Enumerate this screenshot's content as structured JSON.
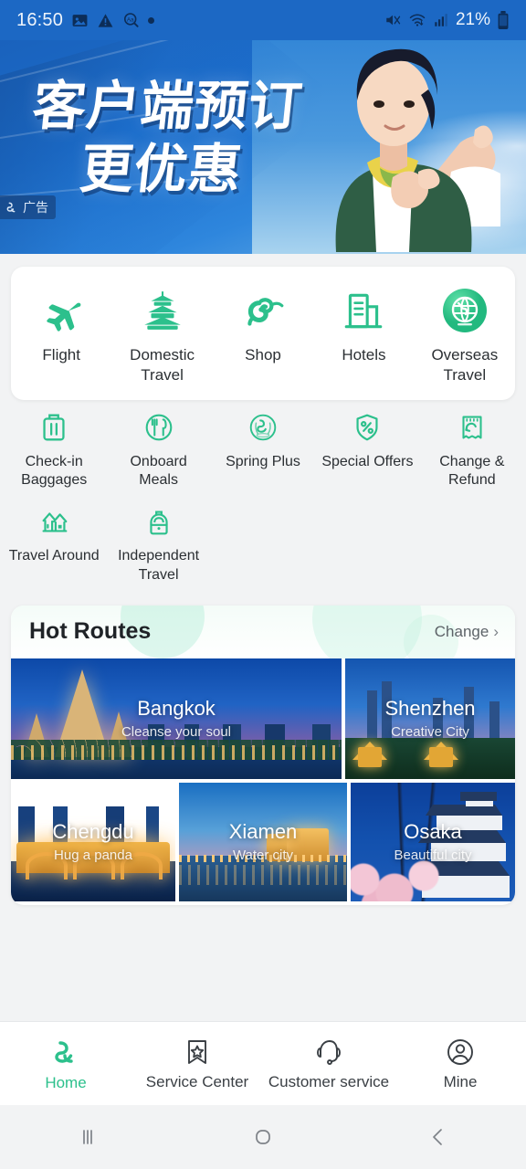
{
  "status_bar": {
    "time": "16:50",
    "left_icons": [
      "image-icon",
      "warning-triangle-icon",
      "text-magnifier-icon",
      "dot-indicator"
    ],
    "battery_percent": "21%",
    "right_icons": [
      "sound-muted-icon",
      "wifi-icon",
      "cellular-signal-icon",
      "battery-icon"
    ]
  },
  "banner": {
    "line1": "客户端预订",
    "line2": "更优惠",
    "ad_label": "广告",
    "background_color": "#1c68c4"
  },
  "primary_grid": [
    {
      "label": "Flight",
      "icon": "airplane-icon"
    },
    {
      "label": "Domestic Travel",
      "icon": "pagoda-icon"
    },
    {
      "label": "Shop",
      "icon": "cloud-swirl-icon"
    },
    {
      "label": "Hotels",
      "icon": "buildings-icon"
    },
    {
      "label": "Overseas Travel",
      "icon": "globe-icon"
    }
  ],
  "secondary_grid": [
    {
      "label": "Check-in Baggages",
      "icon": "suitcase-icon"
    },
    {
      "label": "Onboard Meals",
      "icon": "cutlery-circle-icon"
    },
    {
      "label": "Spring Plus",
      "icon": "spring-seal-icon"
    },
    {
      "label": "Special Offers",
      "icon": "percent-tag-icon"
    },
    {
      "label": "Change & Refund",
      "icon": "refund-receipt-icon"
    },
    {
      "label": "Travel Around",
      "icon": "houses-icon"
    },
    {
      "label": "Independent Travel",
      "icon": "backpack-icon"
    }
  ],
  "hot_routes": {
    "title": "Hot Routes",
    "change_label": "Change",
    "tiles": [
      {
        "name": "Bangkok",
        "tagline": "Cleanse your soul"
      },
      {
        "name": "Shenzhen",
        "tagline": "Creative City"
      },
      {
        "name": "Chengdu",
        "tagline": "Hug a panda"
      },
      {
        "name": "Xiamen",
        "tagline": "Water city"
      },
      {
        "name": "Osaka",
        "tagline": "Beautiful city"
      }
    ]
  },
  "bottom_nav": [
    {
      "label": "Home",
      "icon": "spring-logo-icon",
      "active": true
    },
    {
      "label": "Service Center",
      "icon": "bookmark-star-icon",
      "active": false
    },
    {
      "label": "Customer service",
      "icon": "headset-icon",
      "active": false
    },
    {
      "label": "Mine",
      "icon": "person-circle-icon",
      "active": false
    }
  ],
  "android_nav": [
    {
      "icon": "recents-icon"
    },
    {
      "icon": "home-icon"
    },
    {
      "icon": "back-icon"
    }
  ],
  "theme": {
    "accent": "#2cc08c",
    "banner_blue": "#1c68c4",
    "page_bg": "#f2f3f4"
  }
}
